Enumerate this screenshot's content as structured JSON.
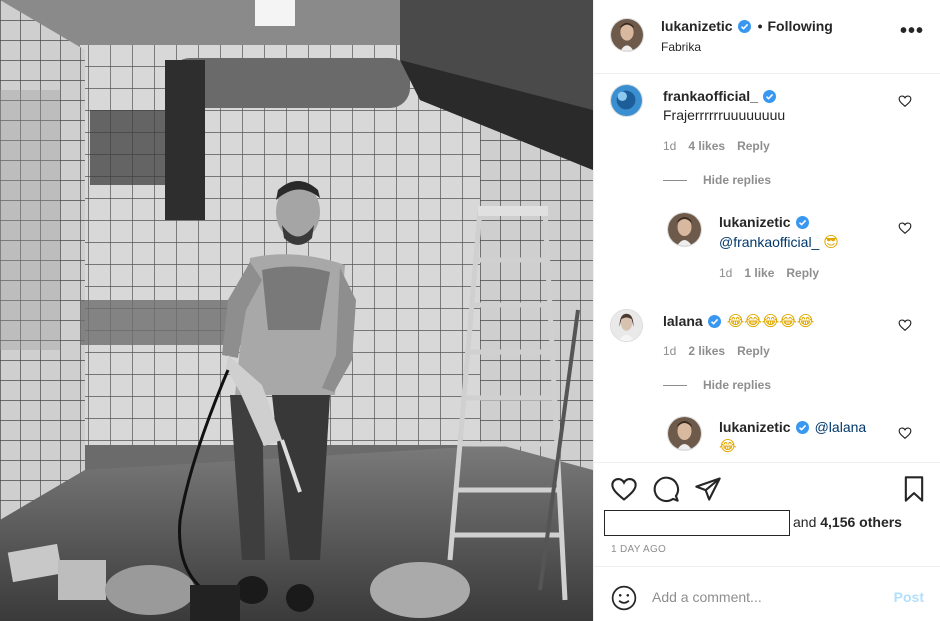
{
  "header": {
    "username": "lukanizetic",
    "dot": "•",
    "follow_status": "Following",
    "location": "Fabrika",
    "more": "•••"
  },
  "comments": [
    {
      "username": "frankaofficial_",
      "text": "Frajerrrrrruuuuuuuu",
      "time": "1d",
      "likes": "4 likes",
      "reply": "Reply",
      "hide_replies": "Hide replies",
      "replies": [
        {
          "username": "lukanizetic",
          "mention": "@frankaofficial_",
          "emoji": "😎",
          "time": "1d",
          "likes": "1 like",
          "reply": "Reply"
        }
      ]
    },
    {
      "username": "lalana",
      "emoji": "😂😂😂😂😂",
      "time": "1d",
      "likes": "2 likes",
      "reply": "Reply",
      "hide_replies": "Hide replies",
      "replies": [
        {
          "username": "lukanizetic",
          "mention": "@lalana",
          "emoji": "😂"
        }
      ]
    }
  ],
  "actions": {
    "likes_prefix": "and",
    "likes_count": "4,156 others",
    "time_ago": "1 DAY AGO",
    "comment_placeholder": "Add a comment...",
    "post_label": "Post"
  },
  "colors": {
    "verified": "#3897f0",
    "meta": "#8e8e8e",
    "mention": "#00376b",
    "post_disabled": "#b2dffc"
  }
}
